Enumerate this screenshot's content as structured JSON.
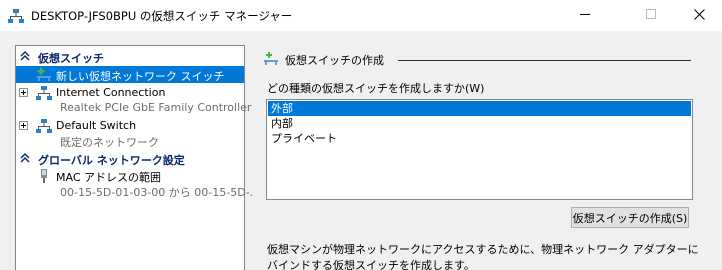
{
  "window": {
    "title": "DESKTOP-JFS0BPU の仮想スイッチ マネージャー",
    "icons": {
      "app": "network-switch-icon",
      "minimize": "minimize-icon",
      "maximize": "maximize-icon",
      "close": "close-icon"
    }
  },
  "tree": {
    "sections": [
      {
        "label": "仮想スイッチ",
        "icon": "chevron-up-icon",
        "items": [
          {
            "label": "新しい仮想ネットワーク スイッチ",
            "sub": "",
            "icon": "add-switch-icon",
            "selected": true
          },
          {
            "label": "Internet Connection",
            "sub": "Realtek PCIe GbE Family Controller",
            "icon": "network-switch-icon",
            "selected": false
          },
          {
            "label": "Default Switch",
            "sub": "既定のネットワーク",
            "icon": "network-switch-icon",
            "selected": false
          }
        ]
      },
      {
        "label": "グローバル ネットワーク設定",
        "icon": "chevron-up-icon",
        "items": [
          {
            "label": "MAC アドレスの範囲",
            "sub": "00-15-5D-01-03-00 から 00-15-5D-...",
            "icon": "mac-address-icon",
            "selected": false
          }
        ]
      }
    ]
  },
  "panel": {
    "title": "仮想スイッチの作成",
    "question": "どの種類の仮想スイッチを作成しますか(W)",
    "options": [
      "外部",
      "内部",
      "プライベート"
    ],
    "selected_option": "外部",
    "create_button": "仮想スイッチの作成(S)",
    "description": "仮想マシンが物理ネットワークにアクセスするために、物理ネットワーク アダプターにバインドする仮想スイッチを作成します。"
  },
  "colors": {
    "selection": "#0078d7",
    "section_header": "#0a246a",
    "panel_bg": "#f0f0f0"
  }
}
